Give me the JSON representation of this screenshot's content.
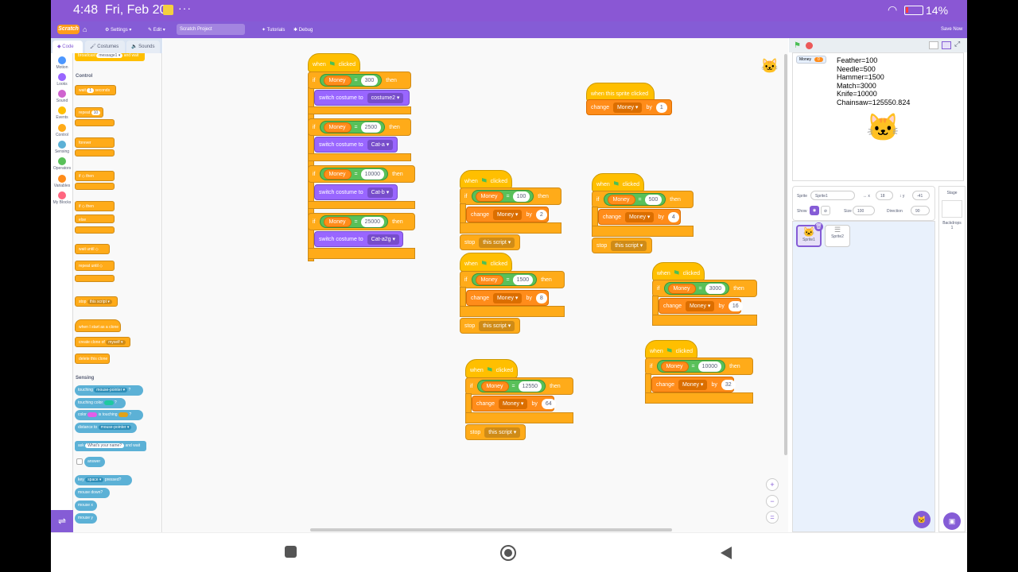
{
  "status": {
    "time": "4:48",
    "date": "Fri, Feb 20",
    "dots": "···",
    "battery": "14%"
  },
  "menu": {
    "logo": "Scratch",
    "settings": "Settings ▾",
    "edit": "Edit ▾",
    "project_title": "Scratch Project",
    "tutorials": "Tutorials",
    "debug": "Debug",
    "save": "Save Now"
  },
  "tabs": {
    "code": "Code",
    "costumes": "Costumes",
    "sounds": "Sounds"
  },
  "categories": [
    "Motion",
    "Looks",
    "Sound",
    "Events",
    "Control",
    "Sensing",
    "Operators",
    "Variables",
    "My Blocks"
  ],
  "category_colors": [
    "#4c97ff",
    "#9966ff",
    "#cf63cf",
    "#ffbf00",
    "#ffab19",
    "#5cb1d6",
    "#59c059",
    "#ff8c1a",
    "#ff6680"
  ],
  "palette": {
    "control_header": "Control",
    "sensing_header": "Sensing",
    "broadcast": "broadcast",
    "message": "message1 ▾",
    "and_wait": "and wait",
    "wait": "wait",
    "wait_val": "1",
    "seconds": "seconds",
    "repeat": "repeat",
    "repeat_val": "10",
    "forever": "forever",
    "if": "if",
    "then": "then",
    "else": "else",
    "wait_until": "wait until",
    "repeat_until": "repeat until",
    "stop": "stop",
    "stop_opt": "this script ▾",
    "clone_start": "when I start as a clone",
    "create_clone": "create clone of",
    "myself": "myself ▾",
    "delete_clone": "delete this clone",
    "touching": "touching",
    "mouse_pointer": "mouse-pointer ▾",
    "q": "?",
    "touching_color": "touching color",
    "color": "color",
    "is_touching": "is touching",
    "distance_to": "distance to",
    "ask": "ask",
    "ask_val": "What's your name?",
    "and_wait2": "and wait",
    "answer": "answer",
    "key": "key",
    "space": "space ▾",
    "pressed": "pressed?",
    "mouse_down": "mouse down?",
    "mouse_x": "mouse x",
    "mouse_y": "mouse y"
  },
  "blocks": {
    "when": "when",
    "clicked": "clicked",
    "if": "if",
    "then": "then",
    "money": "Money",
    "money_dd": "Money ▾",
    "change": "change",
    "by": "by",
    "stop": "stop",
    "this_script": "this script ▾",
    "switch_costume": "switch costume to",
    "sprite_clicked": "when this sprite clicked",
    "costume_script": [
      {
        "cmp": "300",
        "costume": "costume2 ▾"
      },
      {
        "cmp": "2500",
        "costume": "Cat-a ▾"
      },
      {
        "cmp": "10000",
        "costume": "Cat-b ▾"
      },
      {
        "cmp": "25000",
        "costume": "Cat-a2g ▾"
      }
    ],
    "sprite_click_by": "1",
    "scripts": [
      {
        "cmp": "100",
        "by": "2"
      },
      {
        "cmp": "500",
        "by": "4"
      },
      {
        "cmp": "1500",
        "by": "8"
      },
      {
        "cmp": "3000",
        "by": "16"
      },
      {
        "cmp": "10000",
        "by": "32"
      },
      {
        "cmp": "12550",
        "by": "64"
      }
    ]
  },
  "stage": {
    "monitor_label": "Money",
    "monitor_value": "0",
    "prices": [
      "Feather=100",
      "Needle=500",
      "Hammer=1500",
      "Match=3000",
      "Knife=10000",
      "Chainsaw=125550.824"
    ]
  },
  "sprite_info": {
    "sprite_label": "Sprite",
    "sprite_name": "Sprite1",
    "x_label": "x",
    "x": "18",
    "y_label": "y",
    "y": "-41",
    "show": "Show",
    "size_label": "Size",
    "size": "100",
    "direction_label": "Direction",
    "direction": "90"
  },
  "sprites": [
    "Sprite1",
    "Sprite2"
  ],
  "stage_panel": {
    "title": "Stage",
    "backdrops": "Backdrops",
    "count": "1"
  }
}
